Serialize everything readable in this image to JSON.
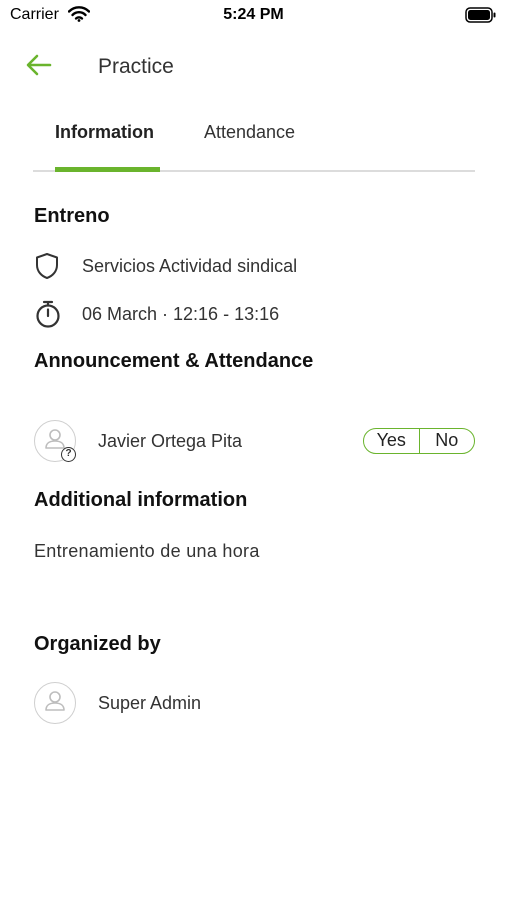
{
  "status_bar": {
    "carrier": "Carrier",
    "time": "5:24 PM"
  },
  "nav": {
    "title": "Practice"
  },
  "tabs": [
    {
      "label": "Information",
      "active": true
    },
    {
      "label": "Attendance",
      "active": false
    }
  ],
  "event": {
    "heading": "Entreno",
    "category": "Servicios Actividad sindical",
    "datetime": "06 March · 12:16 - 13:16"
  },
  "announcement": {
    "heading": "Announcement & Attendance",
    "person": "Javier Ortega Pita",
    "yes_label": "Yes",
    "no_label": "No"
  },
  "additional": {
    "heading": "Additional information",
    "text": "Entrenamiento de una hora"
  },
  "organizer": {
    "heading": "Organized by",
    "name": "Super Admin"
  },
  "colors": {
    "accent": "#6ab42d",
    "divider": "#dcdcdc"
  },
  "icons": [
    "wifi-icon",
    "battery-icon",
    "back-arrow-icon",
    "shield-icon",
    "stopwatch-icon",
    "user-icon",
    "question-icon"
  ]
}
